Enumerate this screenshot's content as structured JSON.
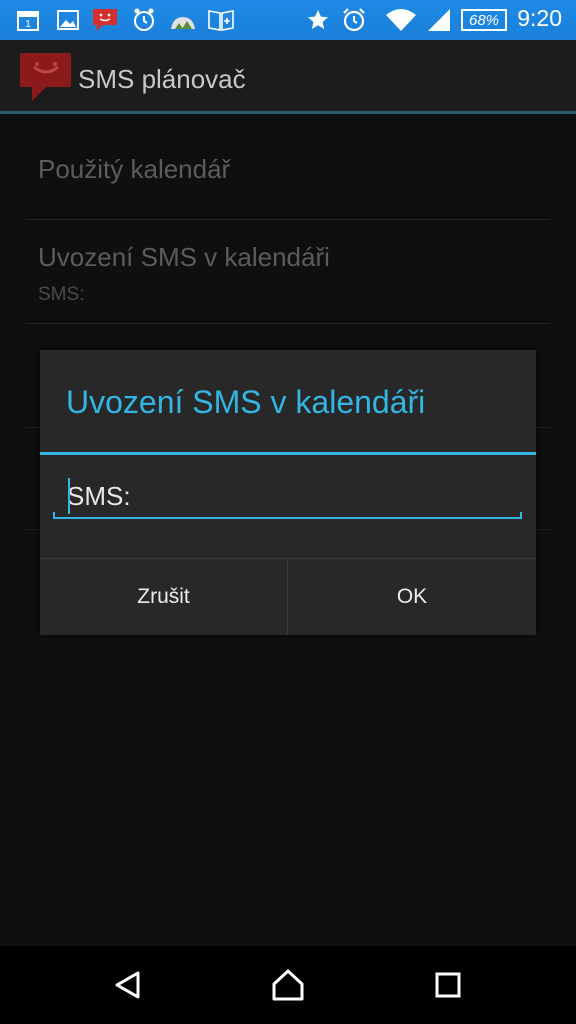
{
  "status_bar": {
    "battery": "68%",
    "time": "9:20",
    "calendar_day": "1",
    "icons": [
      "calendar-icon",
      "image-icon",
      "sms-planner-icon",
      "alarm-clock-app-icon",
      "weather-icon",
      "notes-icon",
      "star-icon",
      "alarm-icon",
      "wifi-icon",
      "signal-icon",
      "battery-icon"
    ]
  },
  "action_bar": {
    "title": "SMS plánovač",
    "icon": "app-logo-icon"
  },
  "settings": {
    "items": [
      {
        "title": "Použitý kalendář",
        "summary": ""
      },
      {
        "title": "Uvození SMS v kalendáři",
        "summary": "SMS:"
      }
    ]
  },
  "dialog": {
    "title": "Uvození SMS v kalendáři",
    "input_value": "SMS:",
    "cancel_label": "Zrušit",
    "ok_label": "OK"
  },
  "colors": {
    "accent": "#33b5e5",
    "status_bar": "#1e88e5",
    "app_icon": "#c62828"
  },
  "nav_bar": {
    "icons": [
      "back-icon",
      "home-icon",
      "recents-icon"
    ]
  }
}
